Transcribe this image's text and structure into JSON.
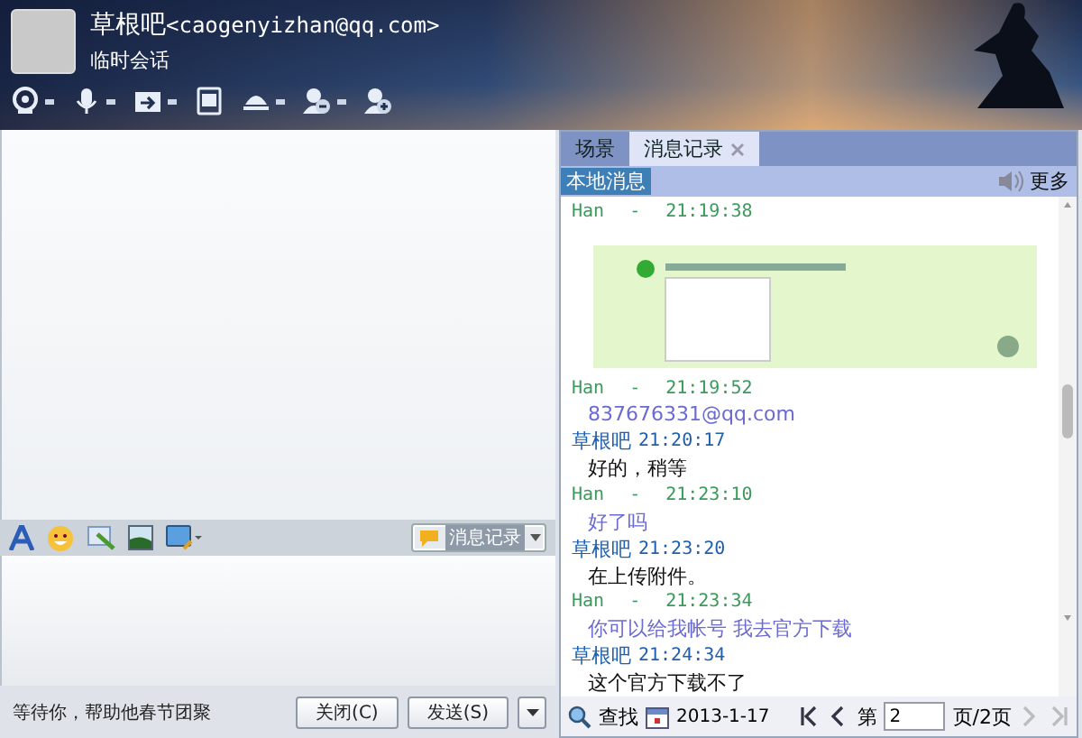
{
  "header": {
    "name": "草根吧",
    "email": "<caogenyizhan@qq.com>",
    "subtitle": "临时会话"
  },
  "header_tools": [
    {
      "kind": "webcam",
      "dropdown": true
    },
    {
      "kind": "mic",
      "dropdown": true
    },
    {
      "kind": "transfer",
      "dropdown": true
    },
    {
      "kind": "screen",
      "dropdown": false
    },
    {
      "kind": "app",
      "dropdown": true
    },
    {
      "kind": "remove-user",
      "dropdown": true
    },
    {
      "kind": "add-user",
      "dropdown": false
    }
  ],
  "history": {
    "tabs": [
      {
        "label": "场景",
        "selected": false,
        "closable": false
      },
      {
        "label": "消息记录",
        "selected": true,
        "closable": true
      }
    ],
    "filter": "本地消息",
    "more": "更多",
    "messages": [
      {
        "kind": "image",
        "sender": "Han",
        "separator": "-",
        "time": "21:19:38"
      },
      {
        "kind": "incoming",
        "sender": "Han",
        "separator": "-",
        "time": "21:19:52",
        "text": "837676331@qq.com"
      },
      {
        "kind": "outgoing",
        "sender": "草根吧",
        "time": "21:20:17",
        "text": "好的，稍等"
      },
      {
        "kind": "incoming",
        "sender": "Han",
        "separator": "-",
        "time": "21:23:10",
        "text": "好了吗"
      },
      {
        "kind": "outgoing",
        "sender": "草根吧",
        "time": "21:23:20",
        "text": "在上传附件。"
      },
      {
        "kind": "incoming",
        "sender": "Han",
        "separator": "-",
        "time": "21:23:34",
        "text": "你可以给我帐号 我去官方下载"
      },
      {
        "kind": "outgoing",
        "sender": "草根吧",
        "time": "21:24:34",
        "text": "这个官方下载不了"
      }
    ],
    "footer": {
      "search": "查找",
      "date": "2013-1-17",
      "page_prefix": "第",
      "page": "2",
      "page_suffix": "页/2页",
      "nav": [
        {
          "kind": "first",
          "disabled": false
        },
        {
          "kind": "prev",
          "disabled": false
        },
        {
          "kind": "next",
          "disabled": true
        },
        {
          "kind": "last",
          "disabled": true
        }
      ]
    }
  },
  "input_tools": [
    {
      "kind": "font"
    },
    {
      "kind": "emoji"
    },
    {
      "kind": "screenshot"
    },
    {
      "kind": "image"
    },
    {
      "kind": "screen"
    }
  ],
  "history_button": {
    "label": "消息记录",
    "selected": true
  },
  "status": "等待你，帮助他春节团聚",
  "buttons": [
    {
      "label": "关闭(C)",
      "kind": "close"
    },
    {
      "label": "发送(S)",
      "kind": "send"
    }
  ]
}
